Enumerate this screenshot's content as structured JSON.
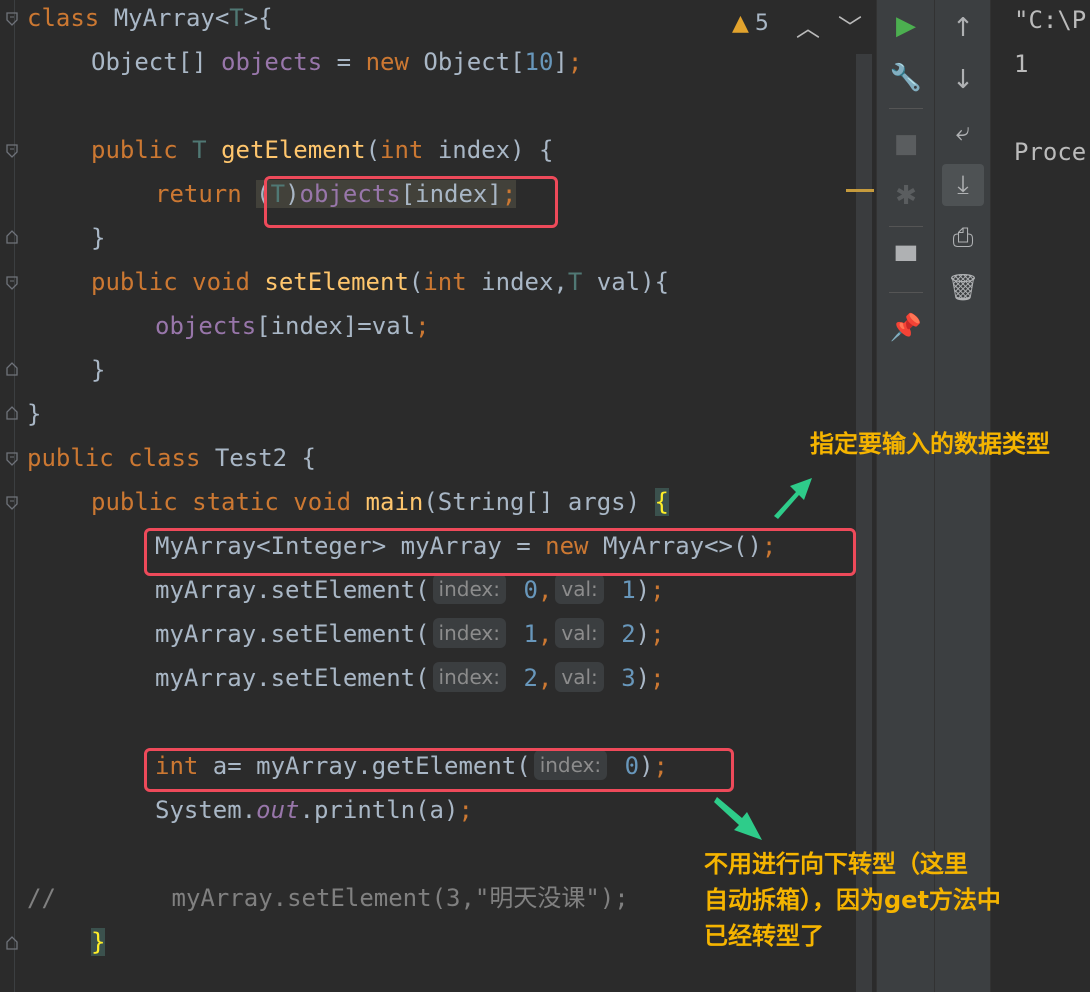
{
  "editor": {
    "warnings": {
      "icon": "warning-triangle-icon",
      "count": "5"
    },
    "nav_up": "︿",
    "nav_down": "﹀"
  },
  "code": {
    "l1": {
      "kw": "class",
      "name": " MyArray<",
      "tp": "T",
      "rest": ">{"
    },
    "l2": {
      "a": "Object[] ",
      "fld": "objects",
      "b": " = ",
      "kw": "new",
      "c": " Object[",
      "num": "10",
      "d": "]",
      "semi": ";"
    },
    "l4": {
      "kw": "public",
      "tp": " T ",
      "fn": "getElement",
      "a": "(",
      "kw2": "int",
      "b": " index) {"
    },
    "l5": {
      "kw": "return",
      "a": " ",
      "lp": "(",
      "tp": "T",
      "rp": ")",
      "fld": "objects",
      "b": "[index]",
      "semi": ";"
    },
    "l6": {
      "a": "}"
    },
    "l7": {
      "kw": "public",
      "kw2": " void ",
      "fn": "setElement",
      "a": "(",
      "kw3": "int",
      "b": " index,",
      "tp": "T",
      "c": " val){"
    },
    "l8": {
      "fld": "objects",
      "a": "[index]=val",
      "semi": ";"
    },
    "l9": {
      "a": "}"
    },
    "l10": {
      "a": "}"
    },
    "l11": {
      "kw": "public class",
      "a": " Test2 {"
    },
    "l12": {
      "kw": "public static void",
      "fn": " main",
      "a": "(String[] args) ",
      "brace": "{"
    },
    "l13": {
      "a": "MyArray<Integer> myArray = ",
      "kw": "new",
      "b": " MyArray<>()",
      "semi": ";"
    },
    "calls": [
      {
        "pre": "myArray.setElement(",
        "h1": "index:",
        "v1": " 0",
        "comma": ",",
        "h2": "val:",
        "v2": " 1",
        "end": ")",
        "semi": ";"
      },
      {
        "pre": "myArray.setElement(",
        "h1": "index:",
        "v1": " 1",
        "comma": ",",
        "h2": "val:",
        "v2": " 2",
        "end": ")",
        "semi": ";"
      },
      {
        "pre": "myArray.setElement(",
        "h1": "index:",
        "v1": " 2",
        "comma": ",",
        "h2": "val:",
        "v2": " 3",
        "end": ")",
        "semi": ";"
      }
    ],
    "l18": {
      "kw": "int",
      "a": " a= myArray.getElement(",
      "h": "index:",
      "v": " 0",
      "b": ")",
      "semi": ";"
    },
    "l19": {
      "a": "System.",
      "it": "out",
      "b": ".println(a)",
      "semi": ";"
    },
    "l21": {
      "cmt": "//        myArray.setElement(3,\"明天没课\");"
    },
    "l22": {
      "brace": "}"
    }
  },
  "toolbar1": [
    {
      "name": "run-icon",
      "glyph": "▶",
      "color": "#4caf50"
    },
    {
      "name": "wrench-icon",
      "glyph": "🔧",
      "color": "#afb1b3"
    },
    {
      "name": "stop-icon",
      "glyph": "■",
      "color": "#5a5d5f"
    },
    {
      "name": "debug-icon",
      "glyph": "✱",
      "color": "#5a5d5f"
    },
    {
      "name": "layout-icon",
      "glyph": "▀",
      "color": "#afb1b3"
    },
    {
      "name": "pin-icon",
      "glyph": "📌",
      "color": "#afb1b3"
    }
  ],
  "toolbar2": [
    {
      "name": "arrow-up-icon",
      "glyph": "↑"
    },
    {
      "name": "arrow-down-icon",
      "glyph": "↓"
    },
    {
      "name": "soft-wrap-icon",
      "glyph": "⤶"
    },
    {
      "name": "scroll-to-end-icon",
      "glyph": "⤓"
    },
    {
      "name": "print-icon",
      "glyph": "⎙"
    },
    {
      "name": "trash-icon",
      "glyph": "🗑"
    }
  ],
  "output": {
    "cmd": "\"C:\\P",
    "value": "1",
    "process": "Proce"
  },
  "annotations": {
    "note1": "指定要输入的数据类型",
    "note2_l1": "不用进行向下转型（这里",
    "note2_l2": "自动拆箱），因为get方法中",
    "note2_l3": "已经转型了"
  }
}
